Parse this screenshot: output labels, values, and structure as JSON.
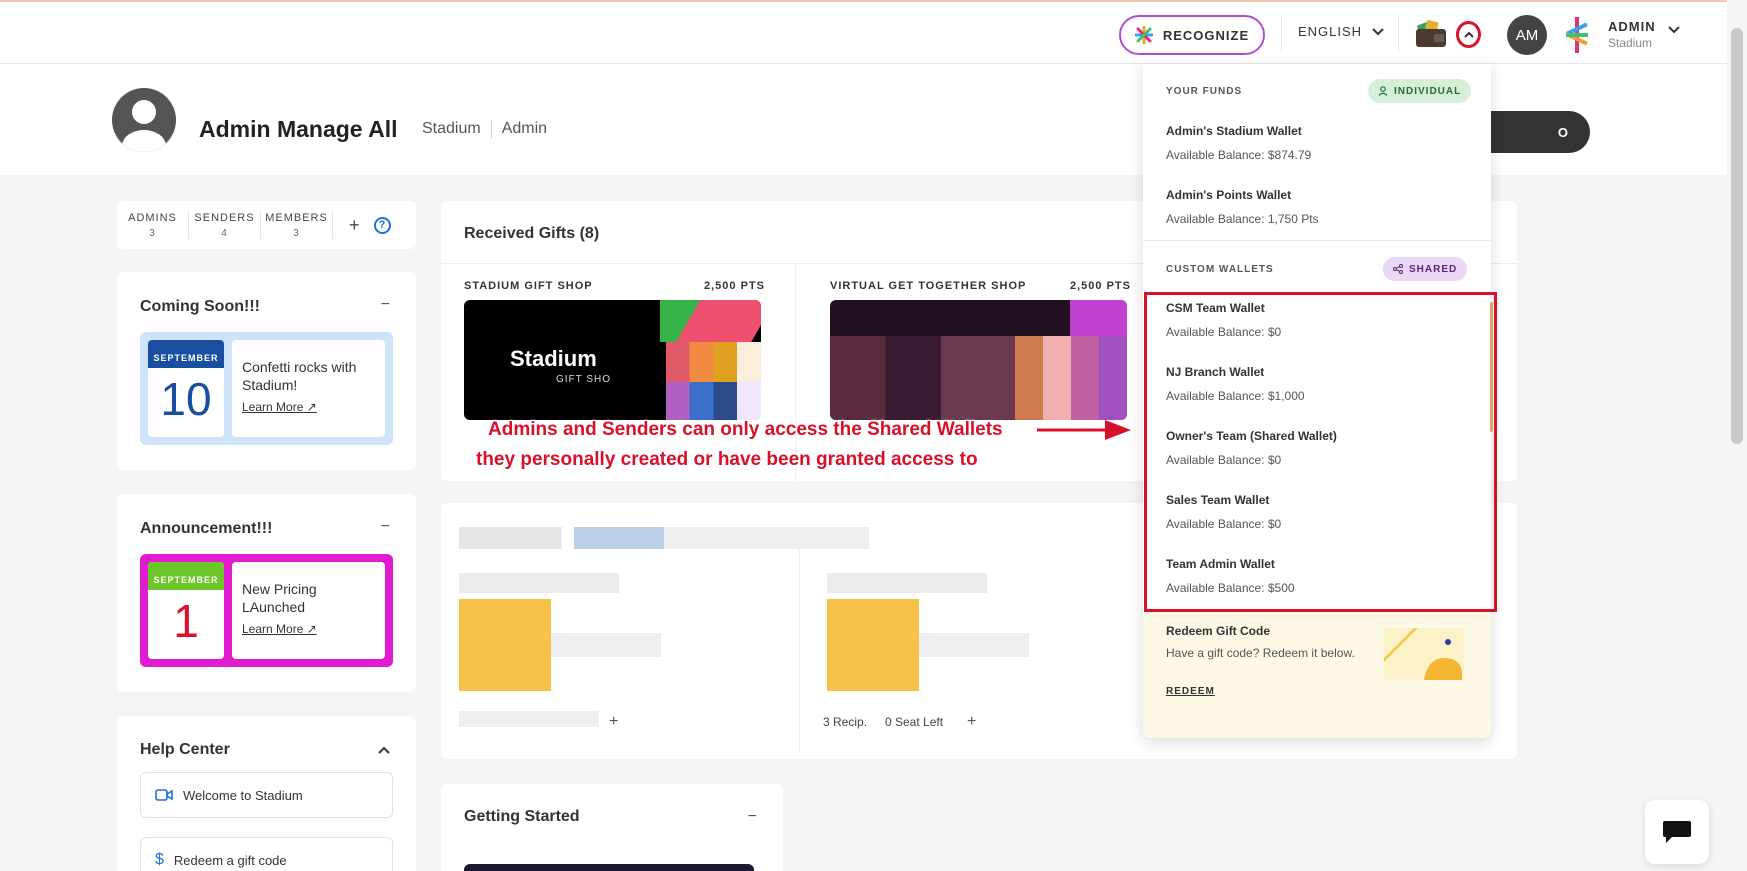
{
  "topbar": {
    "recognize_label": "RECOGNIZE",
    "language": "ENGLISH",
    "avatar_initials": "AM",
    "user_name": "ADMIN",
    "user_org": "Stadium"
  },
  "profile": {
    "name": "Admin Manage All",
    "tags": [
      "Stadium",
      "Admin"
    ],
    "right_button_fragment": "O"
  },
  "counts": [
    {
      "label": "ADMINS",
      "value": "3"
    },
    {
      "label": "SENDERS",
      "value": "4"
    },
    {
      "label": "MEMBERS",
      "value": "3"
    }
  ],
  "coming_soon": {
    "title": "Coming Soon!!!",
    "month": "SEPTEMBER",
    "day": "10",
    "text": "Confetti rocks with Stadium!",
    "link": "Learn More"
  },
  "announcement": {
    "title": "Announcement!!!",
    "month": "SEPTEMBER",
    "day": "1",
    "text": "New Pricing LAunched",
    "link": "Learn More"
  },
  "help_center": {
    "title": "Help Center",
    "items": [
      "Welcome to Stadium",
      "Redeem a gift code"
    ]
  },
  "received_gifts": {
    "title": "Received Gifts (8)",
    "shops": [
      {
        "name": "STADIUM GIFT SHOP",
        "points": "2,500 PTS",
        "logo_text": "Stadium",
        "logo_sub": "GIFT SHO"
      },
      {
        "name": "VIRTUAL GET TOGETHER SHOP",
        "points": "2,500 PTS"
      }
    ],
    "recip_text": "3 Recip.",
    "seat_text": "0 Seat Left"
  },
  "getting_started": {
    "title": "Getting Started"
  },
  "wallet_panel": {
    "your_funds_label": "YOUR FUNDS",
    "individual_label": "INDIVIDUAL",
    "personal_wallets": [
      {
        "name": "Admin's Stadium Wallet",
        "balance": "Available Balance: $874.79"
      },
      {
        "name": "Admin's Points Wallet",
        "balance": "Available Balance: 1,750 Pts"
      }
    ],
    "custom_label": "CUSTOM WALLETS",
    "shared_label": "SHARED",
    "shared_wallets": [
      {
        "name": "CSM Team Wallet",
        "balance": "Available Balance: $0"
      },
      {
        "name": "NJ Branch Wallet",
        "balance": "Available Balance: $1,000"
      },
      {
        "name": "Owner's Team (Shared Wallet)",
        "balance": "Available Balance: $0"
      },
      {
        "name": "Sales Team Wallet",
        "balance": "Available Balance: $0"
      },
      {
        "name": "Team Admin Wallet",
        "balance": "Available Balance: $500"
      }
    ],
    "redeem": {
      "title": "Redeem Gift Code",
      "subtitle": "Have a gift code? Redeem it below.",
      "link": "REDEEM"
    }
  },
  "annotation": {
    "line1": "Admins and Senders can only access the Shared Wallets",
    "line2": "they personally created or have been granted access to"
  },
  "colors": {
    "annotation_red": "#d8102a",
    "recognize_border": "#b44bd6",
    "announcement_magenta": "#e21bd0",
    "coming_soon_blue": "#cfe3fb"
  }
}
